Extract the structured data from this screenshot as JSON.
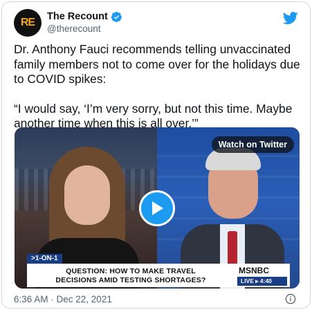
{
  "account": {
    "avatar_text": "RE",
    "display_name": "The Recount",
    "handle": "@therecount"
  },
  "tweet": {
    "paragraph1": "Dr. Anthony Fauci recommends telling unvaccinated family members not to come over for the holidays due to COVID spikes:",
    "paragraph2": "“I would say, ‘I’m very sorry, but not this time. Maybe another time when this is all over.’”",
    "timestamp": "6:36 AM · Dec 22, 2021"
  },
  "video": {
    "watch_label": "Watch on Twitter",
    "chyron_tag": ">1-ON-1",
    "chyron_line1": "QUESTION: HOW TO MAKE TRAVEL",
    "chyron_line2": "DECISIONS AMID TESTING SHORTAGES?",
    "network": "MSNBC",
    "live_label": "LIVE ▸ 4:40"
  },
  "icons": {
    "verified": "verified-badge-icon",
    "twitter": "twitter-bird-icon",
    "play": "play-icon",
    "info": "info-icon"
  },
  "colors": {
    "accent": "#1d9bf0",
    "text": "#0f1419",
    "muted": "#536471",
    "avatar_bg": "#111111",
    "avatar_fg": "#f5a623"
  }
}
